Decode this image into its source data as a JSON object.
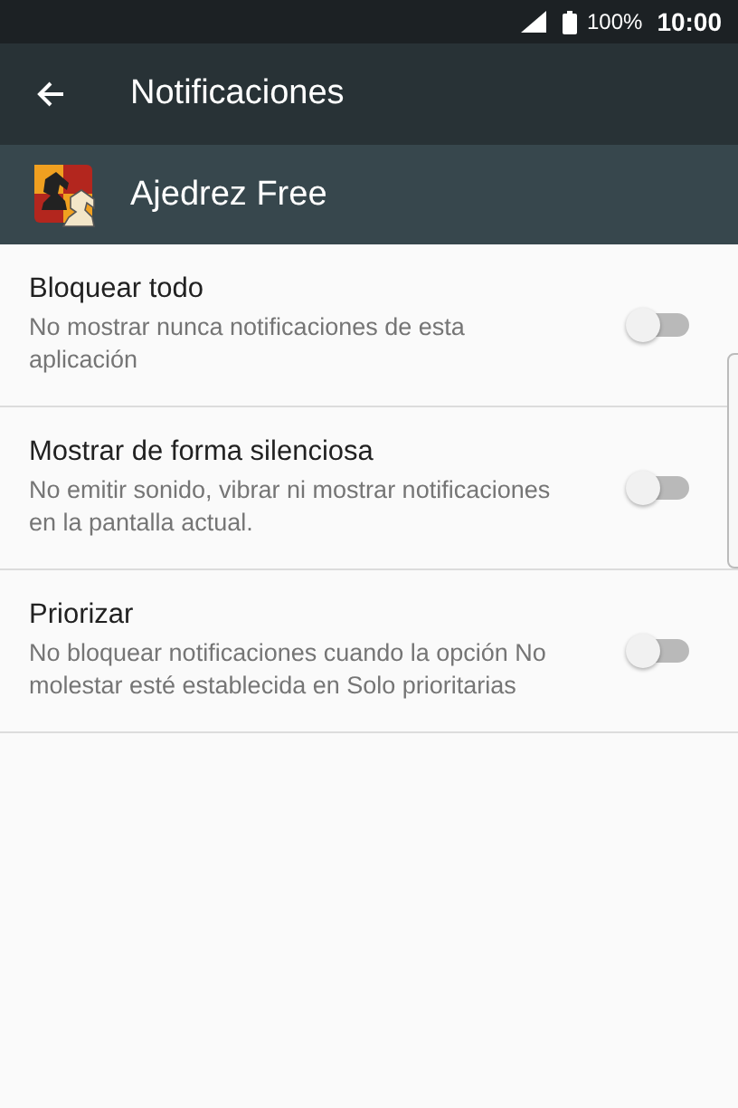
{
  "status_bar": {
    "battery": "100%",
    "time": "10:00"
  },
  "toolbar": {
    "title": "Notificaciones"
  },
  "app_header": {
    "name": "Ajedrez Free"
  },
  "settings": [
    {
      "title": "Bloquear todo",
      "description": "No mostrar nunca notificaciones de esta aplicación",
      "on": false
    },
    {
      "title": "Mostrar de forma silenciosa",
      "description": "No emitir sonido, vibrar ni mostrar notificaciones en la pantalla actual.",
      "on": false
    },
    {
      "title": "Priorizar",
      "description": "No bloquear notificaciones cuando la opción No molestar esté establecida en Solo prioritarias",
      "on": false
    }
  ]
}
